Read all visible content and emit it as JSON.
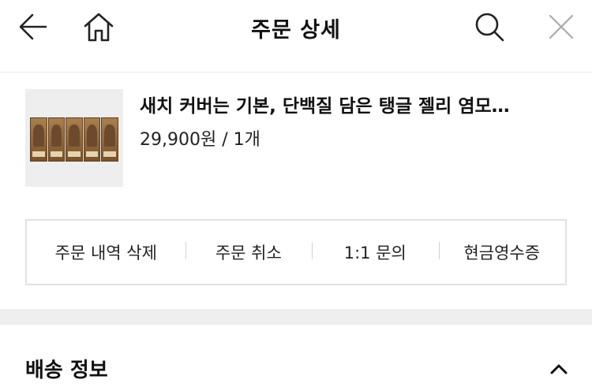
{
  "header": {
    "title": "주문 상세",
    "icons": [
      "back-arrow-icon",
      "home-icon",
      "search-icon",
      "close-icon"
    ]
  },
  "product": {
    "name": "새치 커버는 기본, 단백질 담은 탱글 젤리 염모…",
    "price_quantity": "29,900원 / 1개"
  },
  "actions": {
    "delete": "주문 내역 삭제",
    "cancel": "주문 취소",
    "inquiry": "1:1 문의",
    "receipt": "현금영수증"
  },
  "shipping": {
    "title": "배송 정보"
  }
}
